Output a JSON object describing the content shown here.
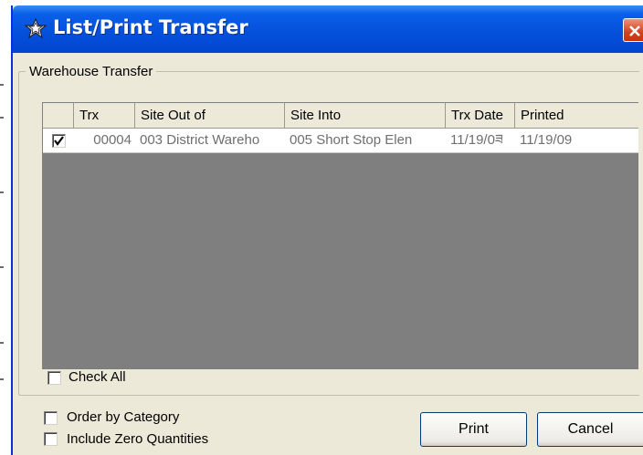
{
  "window": {
    "title": "List/Print Transfer"
  },
  "group": {
    "label": "Warehouse Transfer"
  },
  "grid": {
    "columns": [
      "",
      "Trx",
      "Site Out of",
      "Site Into",
      "Trx Date",
      "Printed"
    ],
    "rows": [
      {
        "checked": true,
        "trx": "00004",
        "site_out": "003 District Wareho",
        "site_into": "005 Short Stop Elen",
        "trx_date": "11/19/0ཟ",
        "printed": "11/19/09"
      }
    ]
  },
  "options": {
    "check_all": "Check All",
    "order_by_category": "Order by Category",
    "include_zero": "Include Zero Quantities"
  },
  "buttons": {
    "print": "Print",
    "cancel": "Cancel"
  },
  "colors": {
    "title_bar": "#0551dc",
    "grid_background": "#7f7f7f",
    "window_face": "#ece9d8",
    "close_button": "#d3411e"
  },
  "icons": {
    "title": "star-icon",
    "close": "close-icon",
    "check": "checkmark-icon"
  }
}
